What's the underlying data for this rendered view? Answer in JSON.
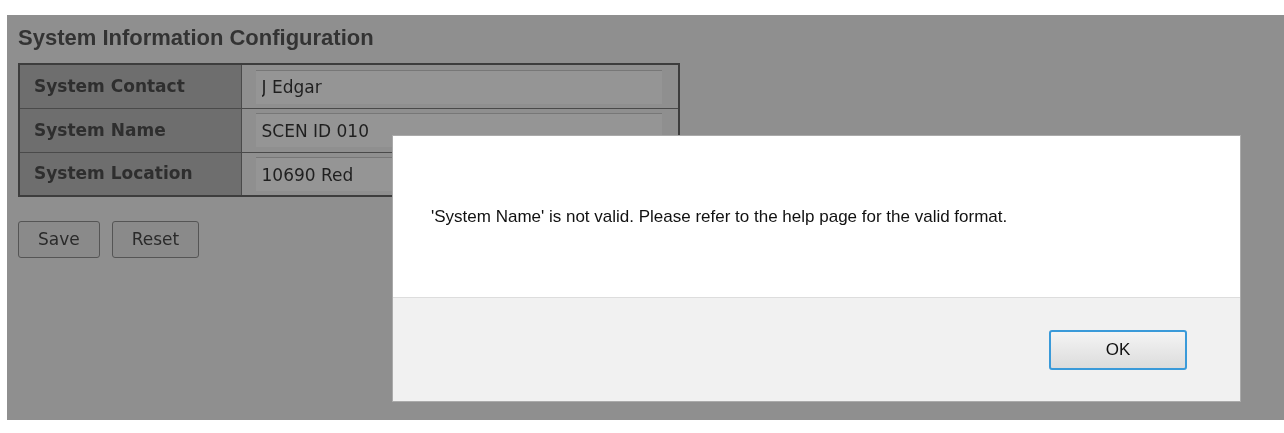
{
  "page": {
    "title": "System Information Configuration"
  },
  "fields": [
    {
      "label": "System Contact",
      "value": "J Edgar"
    },
    {
      "label": "System Name",
      "value": "SCEN ID 010"
    },
    {
      "label": "System Location",
      "value": "10690 Red"
    }
  ],
  "buttons": [
    "Save",
    "Reset"
  ],
  "dialog": {
    "message": "'System Name' is not valid. Please refer to the help page for the valid format.",
    "button": "OK"
  }
}
